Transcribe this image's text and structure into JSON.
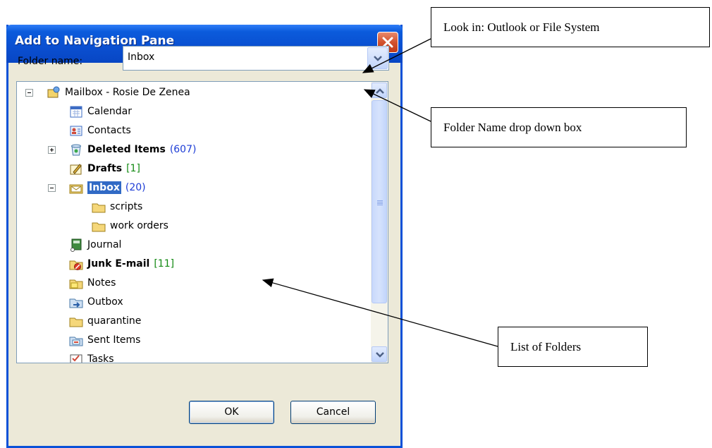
{
  "dialog": {
    "title": "Add to Navigation Pane",
    "folder_name_label": "Folder name:",
    "folder_name_value": "Inbox",
    "tree": [
      {
        "label": "Mailbox - Rosie De Zenea",
        "icon": "mailbox-icon",
        "bold": false
      },
      {
        "label": "Calendar",
        "icon": "calendar-icon",
        "bold": false
      },
      {
        "label": "Contacts",
        "icon": "contacts-icon",
        "bold": false
      },
      {
        "label": "Deleted Items",
        "count": "(607)",
        "count_color": "blue",
        "icon": "deleted-items-icon",
        "bold": true
      },
      {
        "label": "Drafts",
        "count": "[1]",
        "count_color": "green",
        "icon": "drafts-icon",
        "bold": true
      },
      {
        "label": "Inbox",
        "count": "(20)",
        "count_color": "blue",
        "icon": "inbox-icon",
        "bold": true,
        "selected": true
      },
      {
        "label": "scripts",
        "icon": "folder-icon",
        "bold": false
      },
      {
        "label": "work orders",
        "icon": "folder-icon",
        "bold": false
      },
      {
        "label": "Journal",
        "icon": "journal-icon",
        "bold": false
      },
      {
        "label": "Junk E-mail",
        "count": "[11]",
        "count_color": "green",
        "icon": "junk-mail-icon",
        "bold": true
      },
      {
        "label": "Notes",
        "icon": "notes-icon",
        "bold": false
      },
      {
        "label": "Outbox",
        "icon": "outbox-icon",
        "bold": false
      },
      {
        "label": "quarantine",
        "icon": "folder-icon",
        "bold": false
      },
      {
        "label": "Sent Items",
        "icon": "sent-items-icon",
        "bold": false
      },
      {
        "label": "Tasks",
        "icon": "tasks-icon",
        "bold": false
      }
    ],
    "ok_label": "OK",
    "cancel_label": "Cancel"
  },
  "callouts": {
    "look_in": "Look in: Outlook or File System",
    "folder_name_dropdown": "Folder Name drop down box",
    "list_of_folders": "List of Folders"
  },
  "colors": {
    "title_bar": "#0a51d8",
    "dialog_face": "#ece9d8",
    "selection": "#316ac5",
    "count_blue": "#1c3cd6",
    "count_green": "#138a13"
  }
}
